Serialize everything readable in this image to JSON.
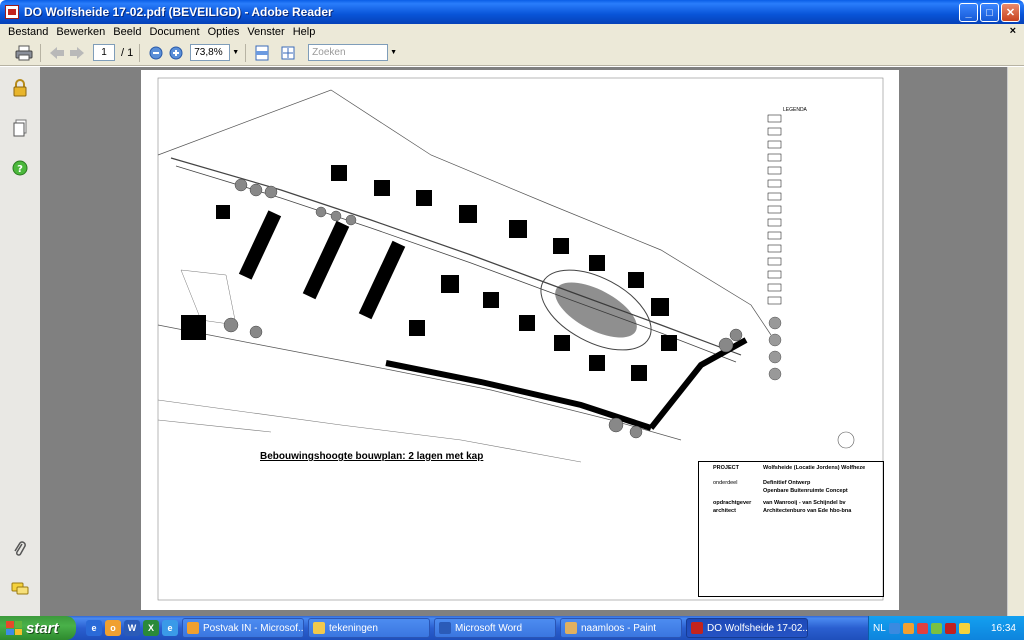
{
  "window": {
    "title": "DO Wolfsheide 17-02.pdf (BEVEILIGD) - Adobe Reader",
    "min_glyph": "_",
    "max_glyph": "□",
    "close_glyph": "✕"
  },
  "menu": {
    "items": [
      "Bestand",
      "Bewerken",
      "Beeld",
      "Document",
      "Opties",
      "Venster",
      "Help"
    ],
    "close_glyph": "×"
  },
  "toolbar": {
    "page_current": "1",
    "page_total": "/ 1",
    "zoom": "73,8%",
    "search_placeholder": "Zoeken"
  },
  "document": {
    "legend_title": "LEGENDA",
    "caption": "Bebouwingshoogte bouwplan: 2 lagen met kap",
    "titleblock": {
      "project_label": "PROJECT",
      "project_value": "Wolfsheide (Locatie Jordens) Wolfheze",
      "onderdeel_label": "onderdeel",
      "onderdeel_value_1": "Definitief Ontwerp",
      "onderdeel_value_2": "Openbare Buitenruimte  Concept",
      "opdrachtgever_label": "opdrachtgever",
      "opdrachtgever_value": "van Wanrooij - van Schijndel bv",
      "architect_label": "architect",
      "architect_value": "Architectenburo van Ede hbo-bna"
    }
  },
  "taskbar": {
    "start_label": "start",
    "tasks": [
      {
        "label": "Postvak IN - Microsof...",
        "color": "#f0a030"
      },
      {
        "label": "tekeningen",
        "color": "#f2c94c"
      },
      {
        "label": "Microsoft Word",
        "color": "#2b5bb8"
      },
      {
        "label": "naamloos - Paint",
        "color": "#e0b060"
      },
      {
        "label": "DO Wolfsheide 17-02...",
        "color": "#c3241d"
      }
    ],
    "language": "NL",
    "clock": "16:34"
  }
}
